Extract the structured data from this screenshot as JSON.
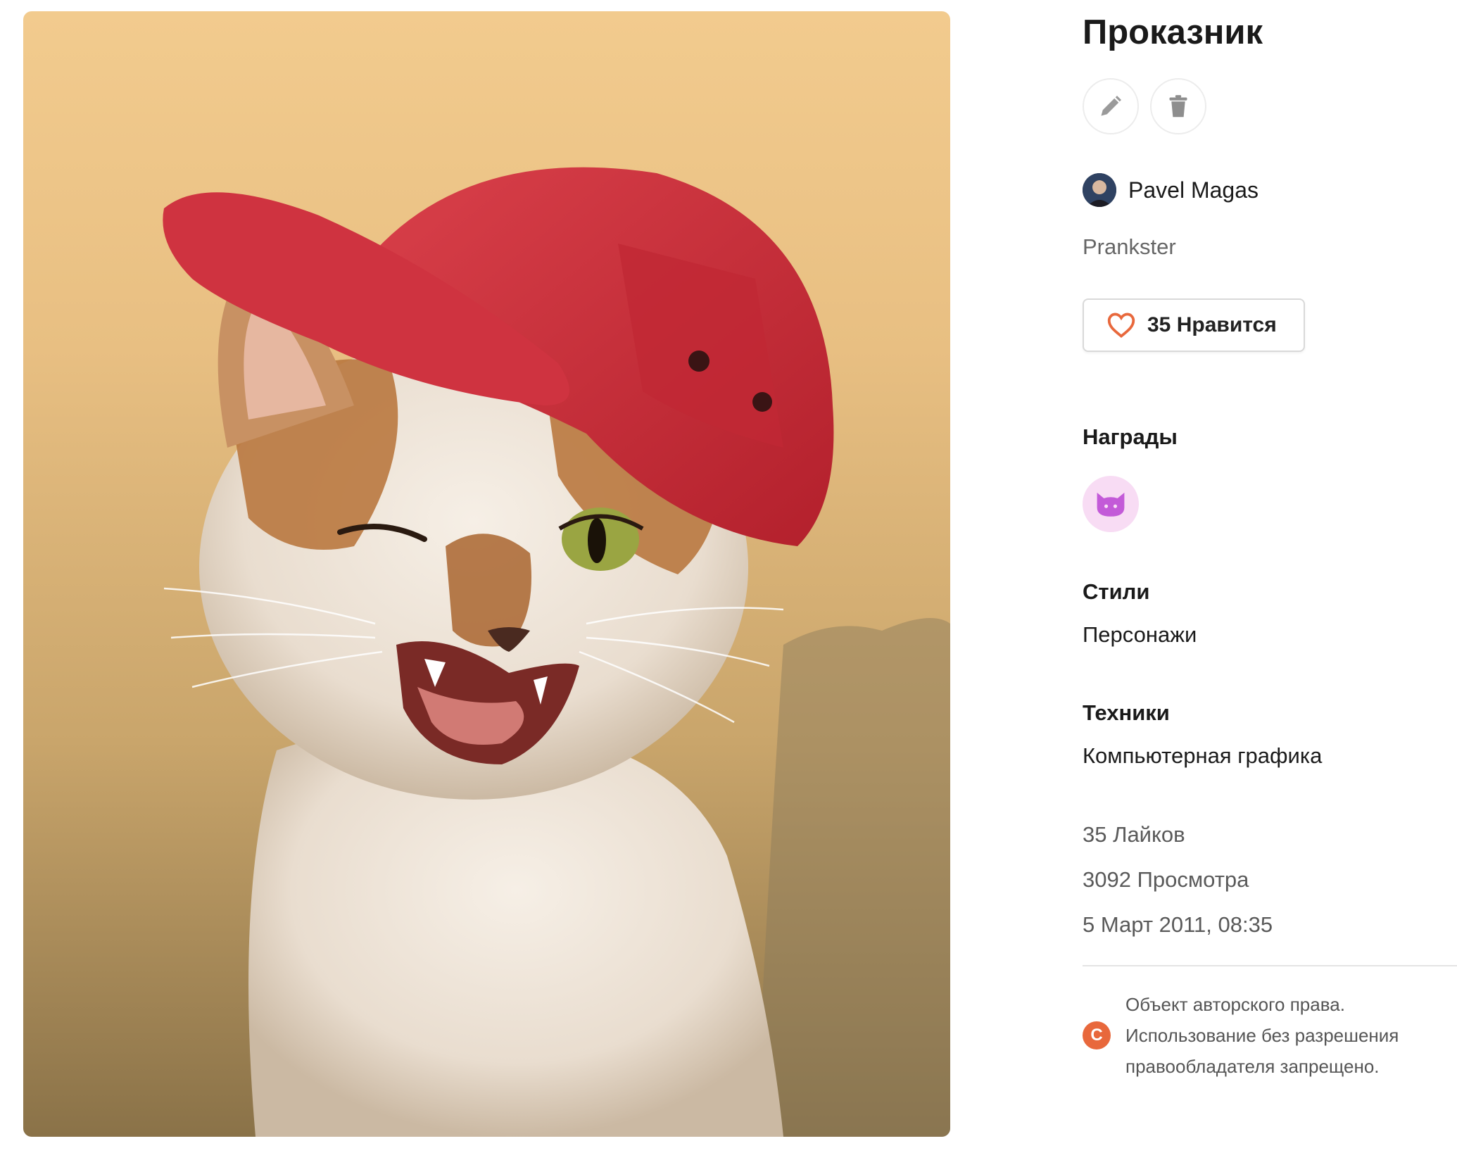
{
  "artwork": {
    "title": "Проказник"
  },
  "actions": {
    "edit": "edit-icon",
    "delete": "trash-icon"
  },
  "author": {
    "name": "Pavel Magas"
  },
  "subtitle": "Prankster",
  "like": {
    "label": "35 Нравится",
    "icon": "heart-icon",
    "color": "#e8683c"
  },
  "awards": {
    "heading": "Награды",
    "items": [
      {
        "icon": "cat-icon",
        "color": "#f8dcf4"
      }
    ]
  },
  "styles": {
    "heading": "Стили",
    "value": "Персонажи"
  },
  "techniques": {
    "heading": "Техники",
    "value": "Компьютерная графика"
  },
  "stats": {
    "likes": "35 Лайков",
    "views": "3092 Просмотра",
    "date": "5 Март 2011, 08:35"
  },
  "copyright": {
    "icon_letter": "C",
    "line1": "Объект авторского права.",
    "line2": "Использование без разрешения",
    "line3": "правообладателя запрещено."
  }
}
